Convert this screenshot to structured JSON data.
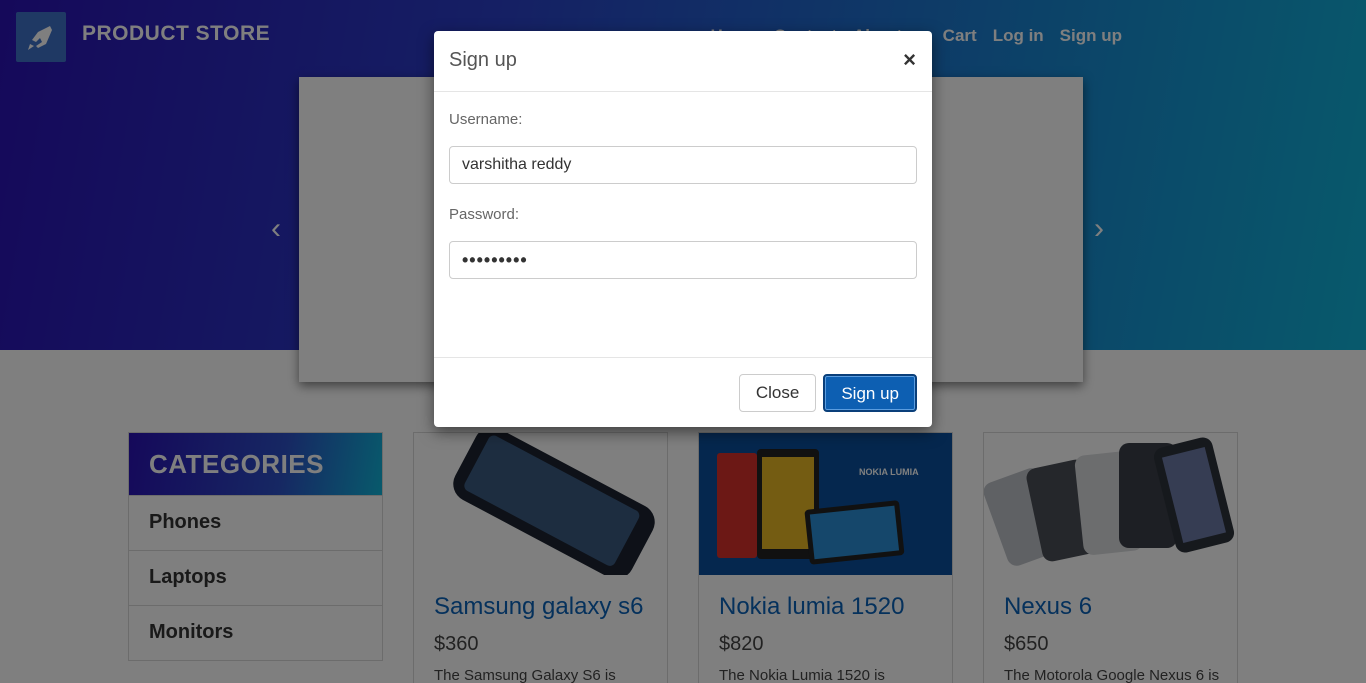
{
  "header": {
    "brand": "PRODUCT STORE",
    "nav": [
      "Home",
      "Contact",
      "About us",
      "Cart",
      "Log in",
      "Sign up"
    ]
  },
  "carousel": {
    "prev_icon": "chevron-left-icon",
    "next_icon": "chevron-right-icon"
  },
  "categories": {
    "title": "CATEGORIES",
    "items": [
      "Phones",
      "Laptops",
      "Monitors"
    ]
  },
  "products": [
    {
      "name": "Samsung galaxy s6",
      "price": "$360",
      "desc": "The Samsung Galaxy S6 is"
    },
    {
      "name": "Nokia lumia 1520",
      "price": "$820",
      "desc": "The Nokia Lumia 1520 is",
      "image_text": "NOKIA LUMIA"
    },
    {
      "name": "Nexus 6",
      "price": "$650",
      "desc": "The Motorola Google Nexus 6 is"
    }
  ],
  "modal": {
    "title": "Sign up",
    "close_symbol": "×",
    "username_label": "Username:",
    "username_value": "varshitha reddy",
    "password_label": "Password:",
    "password_value": "•••••••••",
    "close_button": "Close",
    "signup_button": "Sign up"
  },
  "colors": {
    "accent": "#0d5fb2",
    "title_link": "#0b62b8",
    "hero_start": "#2a12b5",
    "hero_end": "#10b4d8"
  }
}
